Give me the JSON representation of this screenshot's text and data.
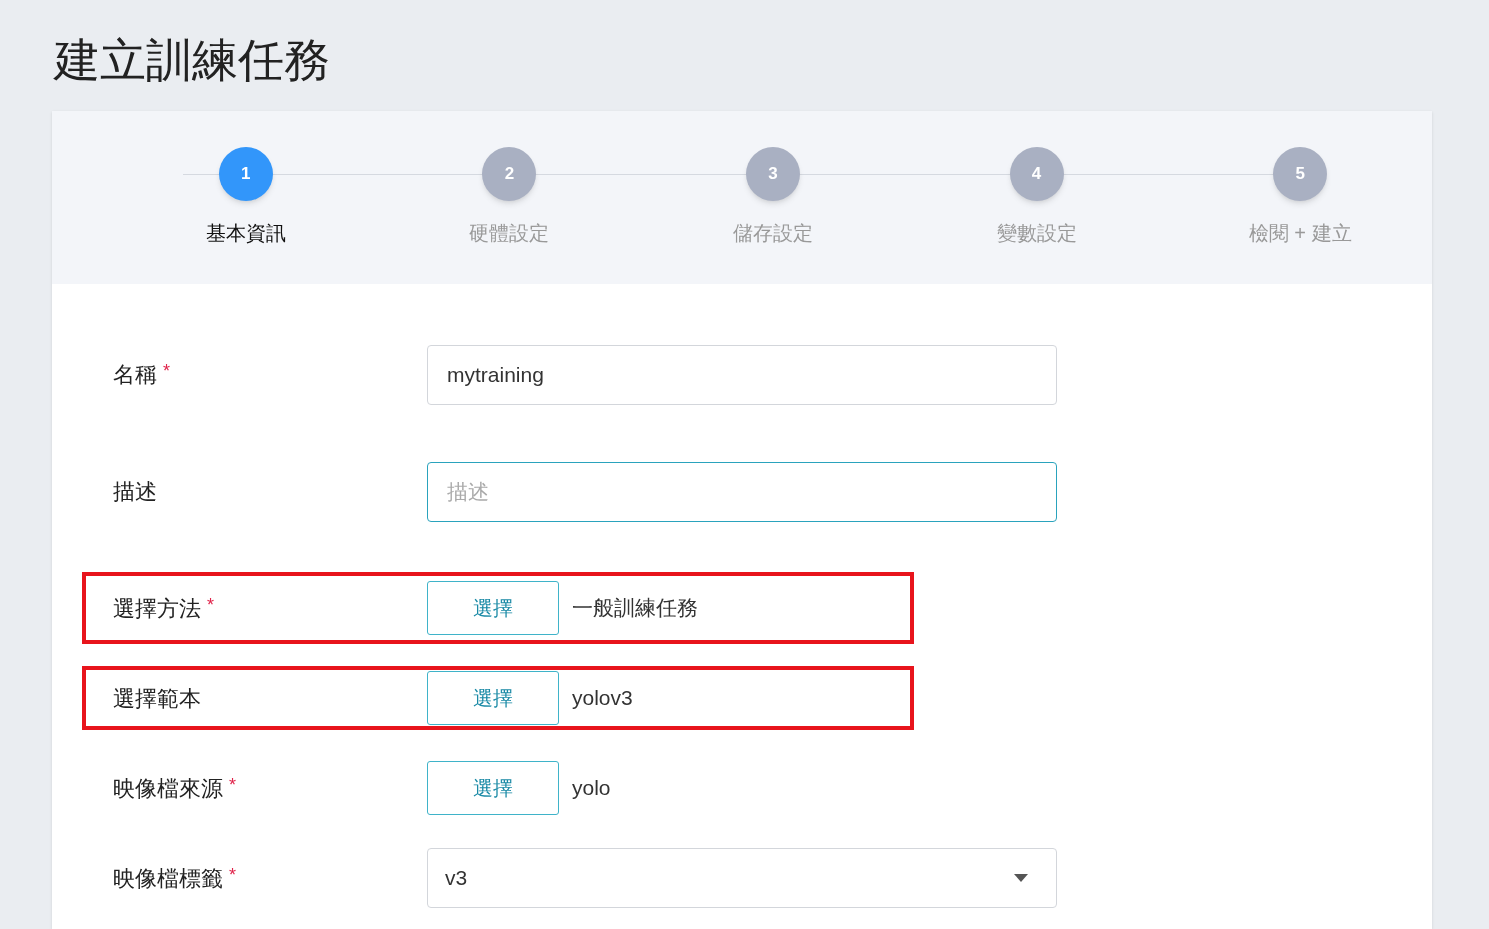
{
  "page_title": "建立訓練任務",
  "steps": [
    {
      "number": "1",
      "label": "基本資訊",
      "selected": true
    },
    {
      "number": "2",
      "label": "硬體設定",
      "selected": false
    },
    {
      "number": "3",
      "label": "儲存設定",
      "selected": false
    },
    {
      "number": "4",
      "label": "變數設定",
      "selected": false
    },
    {
      "number": "5",
      "label": "檢閱 + 建立",
      "selected": false
    }
  ],
  "fields": [
    {
      "kind": "text",
      "label": "名稱",
      "required_mark": "*",
      "value": "mytraining",
      "focused": false,
      "highlighted": false
    },
    {
      "kind": "text",
      "label": "描述",
      "placeholder": "描述",
      "focused": true,
      "highlighted": false
    },
    {
      "kind": "picker",
      "label": "選擇方法",
      "required_mark": "*",
      "button": "選擇",
      "value": "一般訓練任務",
      "highlighted": true
    },
    {
      "kind": "picker",
      "label": "選擇範本",
      "button": "選擇",
      "value": "yolov3",
      "highlighted": true
    },
    {
      "kind": "picker",
      "label": "映像檔來源",
      "required_mark": "*",
      "button": "選擇",
      "value": "yolo",
      "highlighted": false
    },
    {
      "kind": "select",
      "label": "映像檔標籤",
      "required_mark": "*",
      "value": "v3",
      "highlighted": false
    }
  ]
}
